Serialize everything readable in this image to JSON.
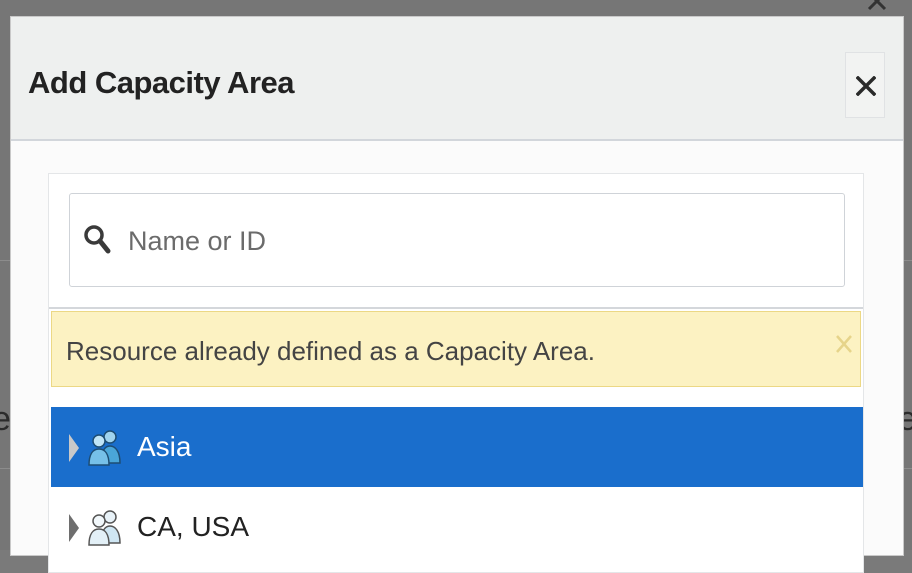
{
  "dialog": {
    "title": "Add Capacity Area",
    "close_label": "X"
  },
  "search": {
    "placeholder": "Name or ID",
    "value": ""
  },
  "alert": {
    "message": "Resource already defined as a Capacity Area."
  },
  "tree": {
    "items": [
      {
        "label": "Asia",
        "selected": true,
        "icon": "group-icon"
      },
      {
        "label": "CA, USA",
        "selected": false,
        "icon": "group-icon"
      }
    ]
  },
  "colors": {
    "selected_row": "#1a6ecc",
    "alert_bg": "#fcf2c2",
    "header_bg": "#eef0ef"
  }
}
